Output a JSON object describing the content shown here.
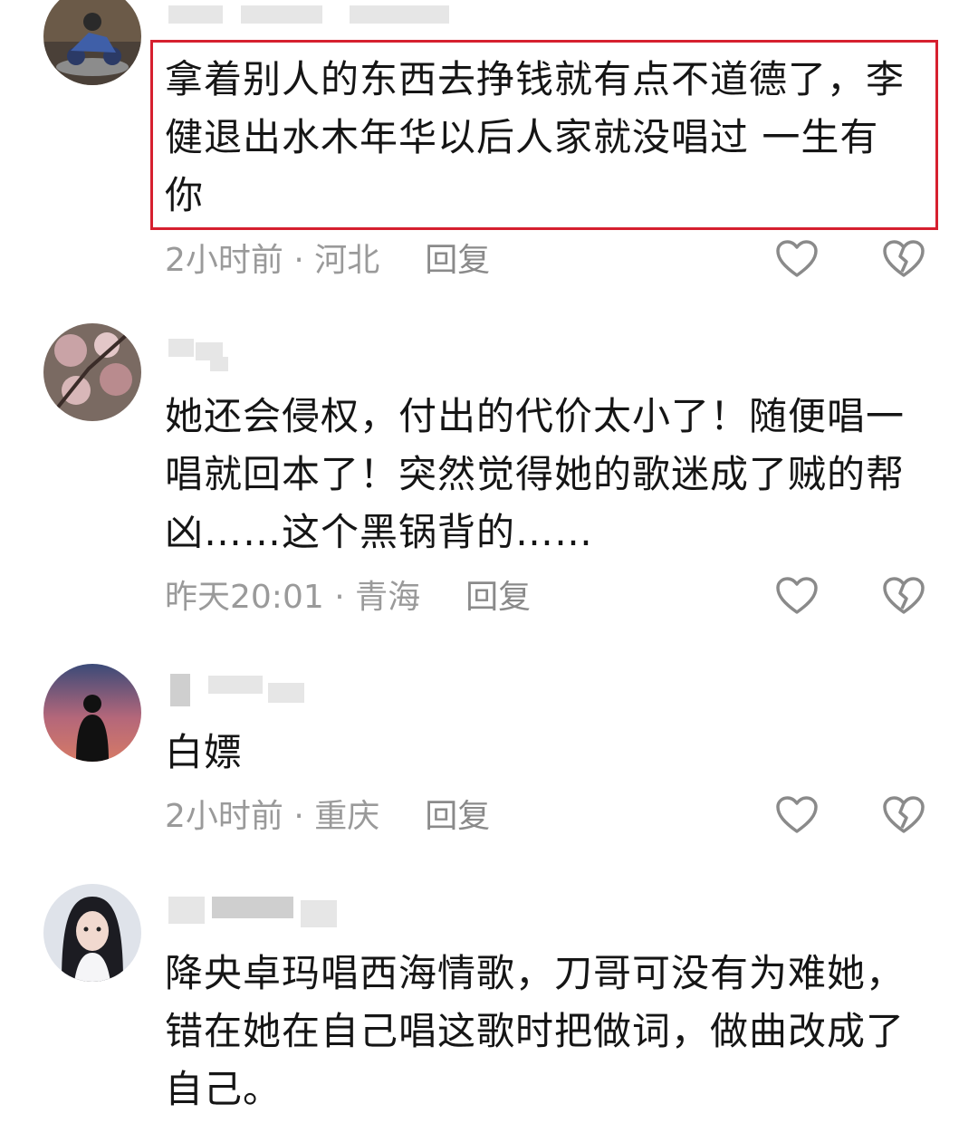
{
  "comments": [
    {
      "text": "拿着别人的东西去挣钱就有点不道德了，李健退出水木年华以后人家就没唱过 一生有你",
      "time": "2小时前",
      "location": "河北",
      "reply_label": "回复",
      "highlighted": true
    },
    {
      "text": "她还会侵权，付出的代价太小了！随便唱一唱就回本了！突然觉得她的歌迷成了贼的帮凶……这个黑锅背的……",
      "time": "昨天20:01",
      "location": "青海",
      "reply_label": "回复"
    },
    {
      "text": "白嫖",
      "time": "2小时前",
      "location": "重庆",
      "reply_label": "回复"
    },
    {
      "text": "降央卓玛唱西海情歌，刀哥可没有为难她，错在她在自己唱这歌时把做词，做曲改成了自己。"
    }
  ],
  "meta_separator": " · ",
  "icons": {
    "like": "heart-outline-icon",
    "dislike": "broken-heart-icon"
  },
  "colors": {
    "highlight_border": "#d6202f",
    "meta_text": "#9a9a9a",
    "body_text": "#151515"
  }
}
